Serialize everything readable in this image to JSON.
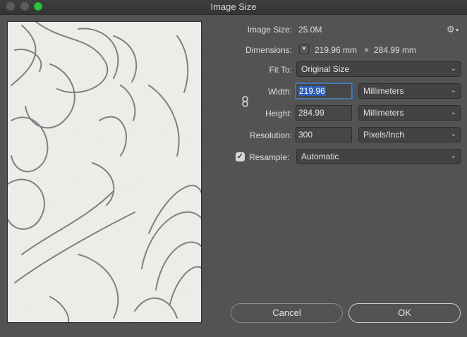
{
  "window": {
    "title": "Image Size"
  },
  "image_size": {
    "label": "Image Size:",
    "value": "25.0M"
  },
  "dimensions": {
    "label": "Dimensions:",
    "width": "219.96 mm",
    "separator": "×",
    "height": "284.99 mm"
  },
  "fit_to": {
    "label": "Fit To:",
    "value": "Original Size"
  },
  "width": {
    "label": "Width:",
    "value": "219.96",
    "unit": "Millimeters"
  },
  "height": {
    "label": "Height:",
    "value": "284.99",
    "unit": "Millimeters"
  },
  "resolution": {
    "label": "Resolution:",
    "value": "300",
    "unit": "Pixels/Inch"
  },
  "resample": {
    "label": "Resample:",
    "checked": true,
    "value": "Automatic"
  },
  "buttons": {
    "cancel": "Cancel",
    "ok": "OK"
  },
  "icons": {
    "settings": "gear-icon",
    "dimensions_toggle": "chevron-down-icon",
    "constrain": "link-icon",
    "checkbox": "checkmark-icon"
  },
  "colors": {
    "focus": "#3b6ea9",
    "selection": "#2e5eb8",
    "zoom_light": "#30c33f"
  }
}
